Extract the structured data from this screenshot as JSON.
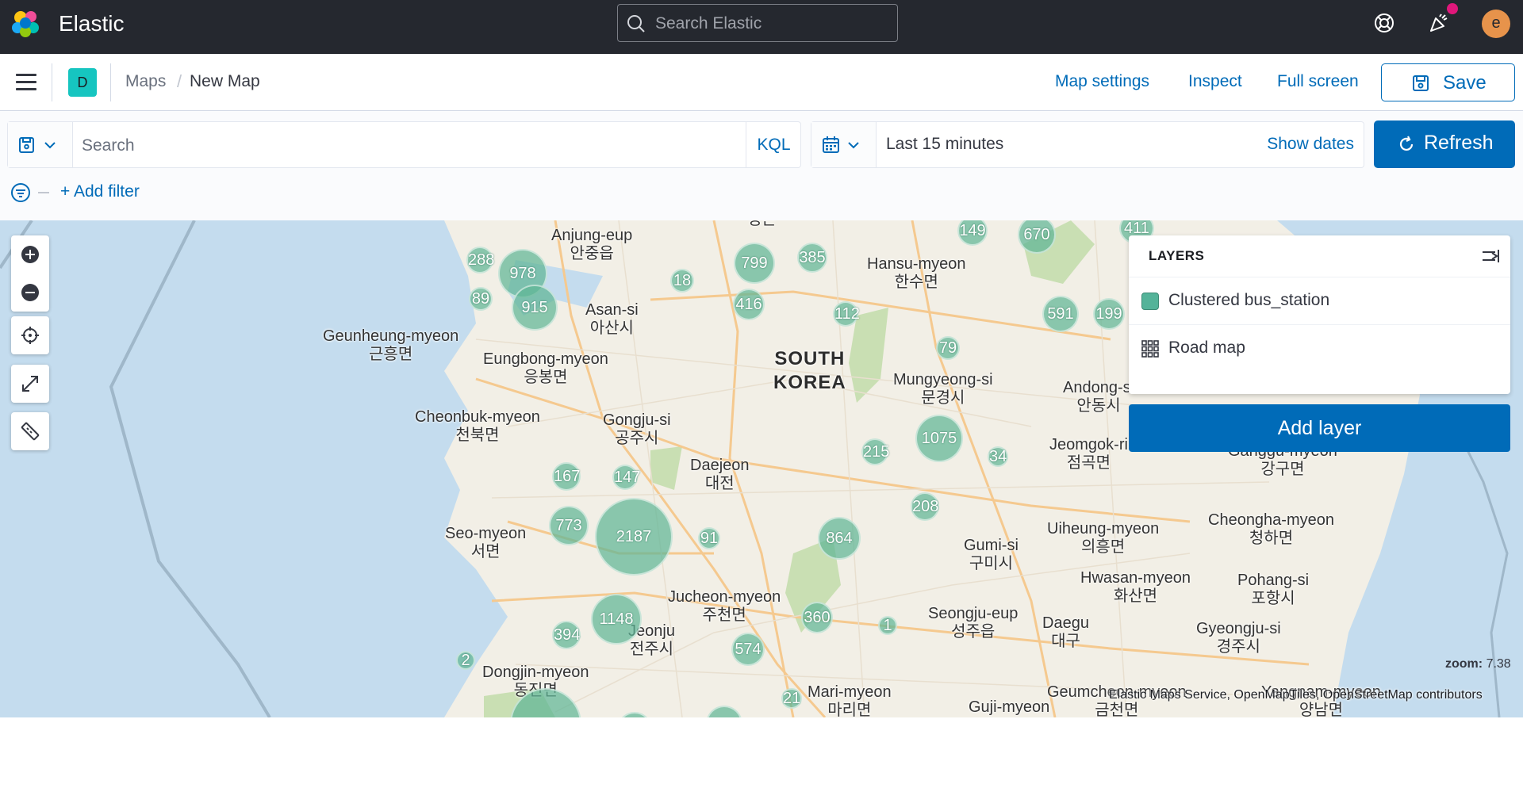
{
  "topbar": {
    "brand": "Elastic",
    "search_placeholder": "Search Elastic",
    "avatar_initial": "e",
    "notification_color": "#e0177b"
  },
  "header": {
    "space_initial": "D",
    "breadcrumbs": [
      "Maps",
      "New Map"
    ],
    "crumb_separator": "/",
    "links": {
      "map_settings": "Map settings",
      "inspect": "Inspect",
      "full_screen": "Full screen"
    },
    "save_label": "Save"
  },
  "querybar": {
    "search_placeholder": "Search",
    "language": "KQL",
    "time_range": "Last 15 minutes",
    "show_dates": "Show dates",
    "refresh_label": "Refresh",
    "add_filter": "+ Add filter"
  },
  "map": {
    "country": "SOUTH\nKOREA",
    "places": [
      {
        "name": "Anjung-eup\n안중읍"
      },
      {
        "name": "Asan-si\n아산시"
      },
      {
        "name": "Hansu-myeon\n한수면"
      },
      {
        "name": "Geunheung-myeon\n근흥면"
      },
      {
        "name": "Eungbong-myeon\n응봉면"
      },
      {
        "name": "Mungyeong-si\n문경시"
      },
      {
        "name": "Andong-si\n안동시"
      },
      {
        "name": "Cheonbuk-myeon\n천북면"
      },
      {
        "name": "Gongju-si\n공주시"
      },
      {
        "name": "Daejeon\n대전"
      },
      {
        "name": "Jeomgok-ri\n점곡면"
      },
      {
        "name": "Ganggu-myeon\n강구면"
      },
      {
        "name": "Seo-myeon\n서면"
      },
      {
        "name": "Cheongha-myeon\n청하면"
      },
      {
        "name": "Uiheung-myeon\n의흥면"
      },
      {
        "name": "Gumi-si\n구미시"
      },
      {
        "name": "Hwasan-myeon\n화산면"
      },
      {
        "name": "Pohang-si\n포항시"
      },
      {
        "name": "Jucheon-myeon\n주천면"
      },
      {
        "name": "Seongju-eup\n성주읍"
      },
      {
        "name": "Daegu\n대구"
      },
      {
        "name": "Gyeongju-si\n경주시"
      },
      {
        "name": "Jeonju\n전주시"
      },
      {
        "name": "Dongjin-myeon\n동진면"
      },
      {
        "name": "Mari-myeon\n마리면"
      },
      {
        "name": "Guji-myeon"
      },
      {
        "name": "Geumcheon-myeon\n금천면"
      },
      {
        "name": "Yangnam-myeon\n양남면"
      },
      {
        "name": "평은"
      }
    ],
    "clusters": [
      "288",
      "978",
      "89",
      "915",
      "18",
      "799",
      "385",
      "149",
      "670",
      "411",
      "416",
      "112",
      "591",
      "199",
      "79",
      "1075",
      "215",
      "34",
      "167",
      "147",
      "773",
      "2187",
      "91",
      "208",
      "864",
      "1148",
      "360",
      "394",
      "574",
      "1",
      "2",
      "21"
    ],
    "zoom_label": "zoom:",
    "zoom_value": "7.38",
    "attribution": "Elastic Maps Service, OpenMapTiles, OpenStreetMap contributors",
    "land_color": "#f2efe6",
    "water_color": "#c4dcee",
    "cluster_color": "#54b399"
  },
  "layers_panel": {
    "title": "LAYERS",
    "layers": [
      {
        "name": "Clustered bus_station",
        "icon": "teal-square-icon"
      },
      {
        "name": "Road map",
        "icon": "grid-icon"
      }
    ],
    "add_layer_label": "Add layer"
  }
}
